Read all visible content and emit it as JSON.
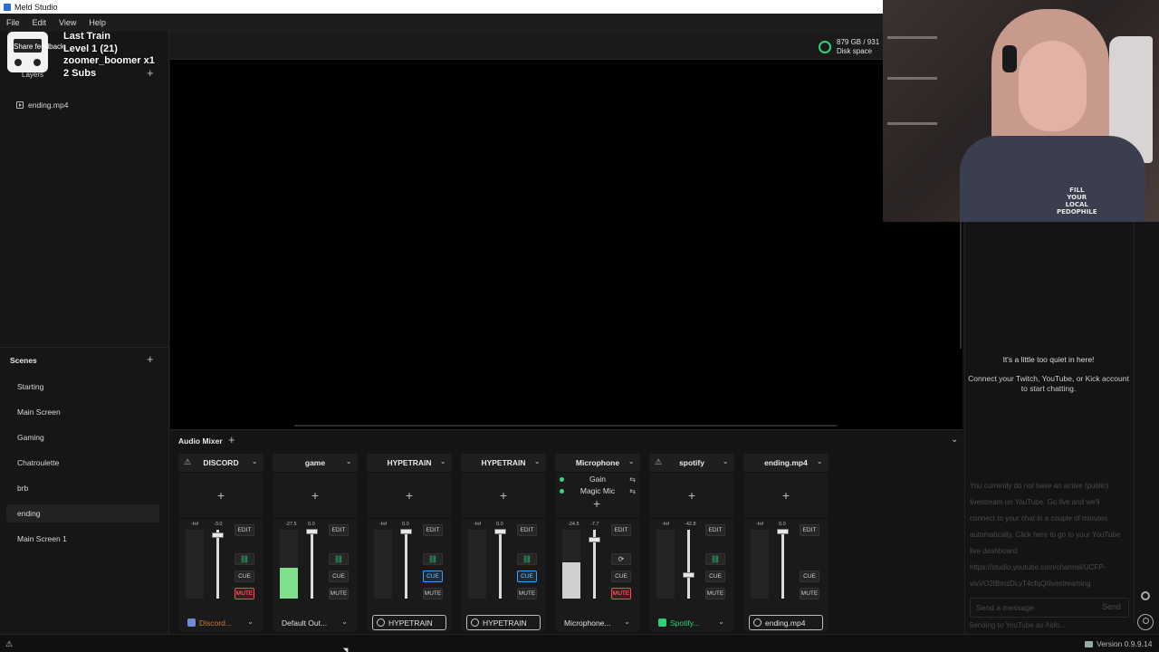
{
  "titlebar": {
    "title": "Meld Studio"
  },
  "menu": [
    "File",
    "Edit",
    "View",
    "Help"
  ],
  "overlay": {
    "share_feedback": "Share feedback",
    "alert_lines": [
      "Last Train",
      "Level 1  (21)",
      "zoomer_boomer x1",
      "2 Subs"
    ]
  },
  "layers": {
    "label": "Layers",
    "items": [
      "ending.mp4"
    ]
  },
  "scenes": {
    "title": "Scenes",
    "items": [
      "Starting",
      "Main Screen",
      "Gaming",
      "Chatroulette",
      "brb",
      "ending",
      "Main Screen 1"
    ],
    "active": "ending"
  },
  "disk": {
    "line1": "879 GB / 931",
    "line2": "Disk space",
    "color": "#2fd27a"
  },
  "webcam": {
    "shirt_text": "FILL\nYOUR\nLOCAL\nPEDOPHILE"
  },
  "chat": {
    "empty_title": "It's a little too quiet in here!",
    "empty_sub": "Connect your Twitch, YouTube, or Kick account to start chatting.",
    "yt_notice": "You currently do not have an active (public) livestream on YouTube. Go live and we'll connect to your chat in a couple of minutes automatically. Click here to go to your YouTube live dashboard: https://studio.youtube.com/channel/UCFP-vivVO2tBmzDLyT4cfqQ/livestreaming",
    "input_placeholder": "Send a message",
    "send_label": "Send",
    "sending_as": "Sending to YouTube as Aido..."
  },
  "mixer": {
    "title": "Audio Mixer",
    "channels": [
      {
        "name": "DISCORD",
        "warn": true,
        "meter_label": "-Inf",
        "fader_label": "-3.0",
        "fader_pos": 0.08,
        "meter_fill": 0,
        "cue_on": false,
        "mute_on": true,
        "show_link": true,
        "source": "Discord...",
        "source_icon": "discord-icon",
        "source_color": "#d27a2f",
        "source_icon_color": "#6c8cd8",
        "boxed": false
      },
      {
        "name": "game",
        "warn": false,
        "meter_label": "-27.5",
        "fader_label": "0.0",
        "fader_pos": 0.03,
        "meter_fill": 0.45,
        "cue_on": false,
        "mute_on": false,
        "show_link": true,
        "source": "Default Out...",
        "source_icon": "",
        "source_color": "#e0e0e0",
        "boxed": false
      },
      {
        "name": "HYPETRAIN",
        "warn": false,
        "meter_label": "-Inf",
        "fader_label": "0.0",
        "fader_pos": 0.03,
        "meter_fill": 0,
        "cue_on": true,
        "mute_on": false,
        "show_link": true,
        "source": "HYPETRAIN",
        "source_icon": "globe-icon",
        "source_color": "#e0e0e0",
        "boxed": true
      },
      {
        "name": "HYPETRAIN",
        "warn": false,
        "meter_label": "-Inf",
        "fader_label": "0.0",
        "fader_pos": 0.03,
        "meter_fill": 0,
        "cue_on": true,
        "mute_on": false,
        "show_link": true,
        "source": "HYPETRAIN",
        "source_icon": "globe-icon",
        "source_color": "#e0e0e0",
        "boxed": true
      },
      {
        "name": "Microphone",
        "warn": false,
        "meter_label": "-24.5",
        "fader_label": "-7.7",
        "fader_pos": 0.14,
        "meter_fill": 0.52,
        "cue_on": false,
        "mute_on": true,
        "show_link": false,
        "source": "Microphone...",
        "source_icon": "",
        "source_color": "#e0e0e0",
        "boxed": false,
        "filters": [
          "Gain",
          "Magic Mic"
        ]
      },
      {
        "name": "spotify",
        "warn": true,
        "meter_label": "-Inf",
        "fader_label": "-42.8",
        "fader_pos": 0.66,
        "meter_fill": 0,
        "cue_on": false,
        "mute_on": false,
        "show_link": true,
        "source": "Spotify...",
        "source_icon": "spotify-icon",
        "source_color": "#2fd27a",
        "source_icon_color": "#2fd27a",
        "boxed": false
      },
      {
        "name": "ending.mp4",
        "warn": false,
        "meter_label": "-Inf",
        "fader_label": "0.0",
        "fader_pos": 0.03,
        "meter_fill": 0,
        "cue_on": false,
        "mute_on": false,
        "show_link": false,
        "source": "ending.mp4",
        "source_icon": "video-file-icon",
        "source_color": "#e0e0e0",
        "boxed": true
      }
    ],
    "labels": {
      "edit": "EDIT",
      "cue": "CUE",
      "mute": "MUTE"
    }
  },
  "status": {
    "version": "Version 0.9.9.14"
  }
}
